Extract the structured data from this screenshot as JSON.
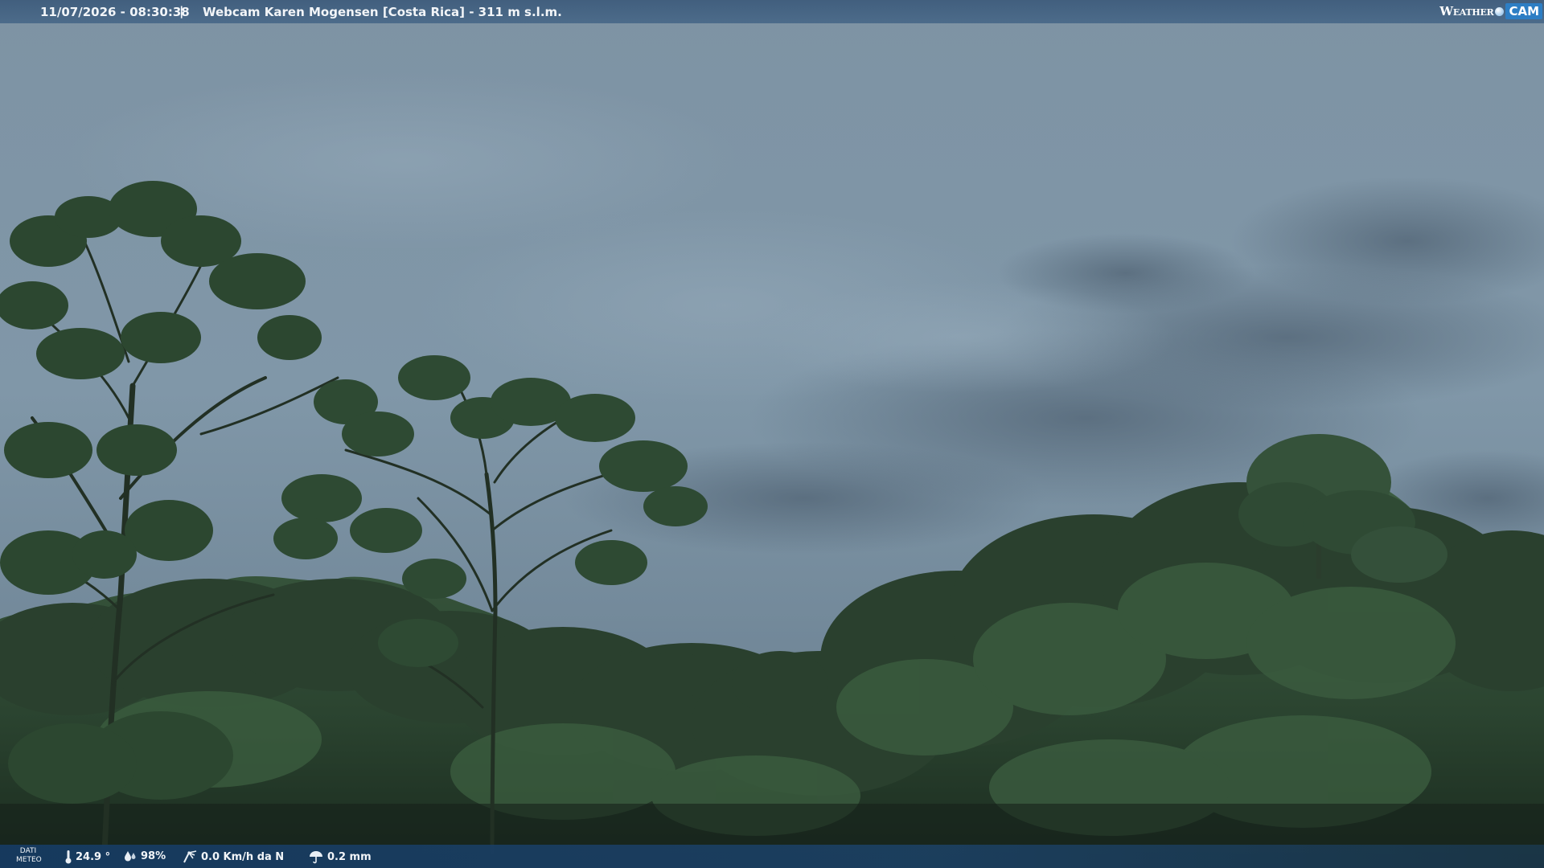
{
  "header": {
    "datetime": "11/07/2026 - 08:30:38",
    "separator": "|",
    "location": "Webcam Karen Mogensen [Costa Rica]  - 311 m s.l.m."
  },
  "logo": {
    "weather_text": "Weather",
    "cam_text": "CAM"
  },
  "footer": {
    "dati_line1": "DATI",
    "dati_line2": "METEO",
    "temperature": "24.9 °",
    "humidity": "98%",
    "wind": "0.0 Km/h da N",
    "rain": "0.2 mm"
  },
  "colors": {
    "sky_top": "#7e93a4",
    "sky_mid": "#8198a9",
    "cloud_dark": "#5f7384",
    "forest_dark": "#1f2e22",
    "forest_mid": "#2e4630",
    "forest_light": "#3f6040",
    "bar_top": "#40607f",
    "bar_bottom": "#1b3f64"
  }
}
